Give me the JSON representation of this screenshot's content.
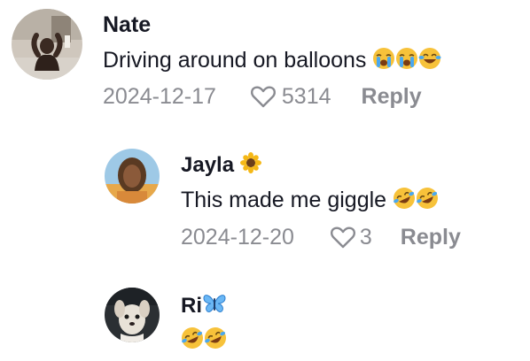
{
  "comments": [
    {
      "username": "Nate",
      "text": "Driving around on balloons",
      "emojis": [
        "loudly-crying-face",
        "loudly-crying-face",
        "face-with-tears-of-joy"
      ],
      "date": "2024-12-17",
      "likes": "5314",
      "reply_label": "Reply",
      "avatar": "avatar-nate"
    },
    {
      "username": "Jayla",
      "username_emoji": "sunflower",
      "text": "This made me giggle",
      "emojis": [
        "rolling-on-floor-laughing",
        "rolling-on-floor-laughing"
      ],
      "date": "2024-12-20",
      "likes": "3",
      "reply_label": "Reply",
      "avatar": "avatar-jayla"
    },
    {
      "username": "Ri",
      "username_emoji": "butterfly",
      "text": "",
      "emojis": [
        "rolling-on-floor-laughing",
        "rolling-on-floor-laughing"
      ],
      "avatar": "avatar-ri"
    }
  ],
  "colors": {
    "text": "#161823",
    "muted": "#8a8b91",
    "background": "#ffffff"
  }
}
